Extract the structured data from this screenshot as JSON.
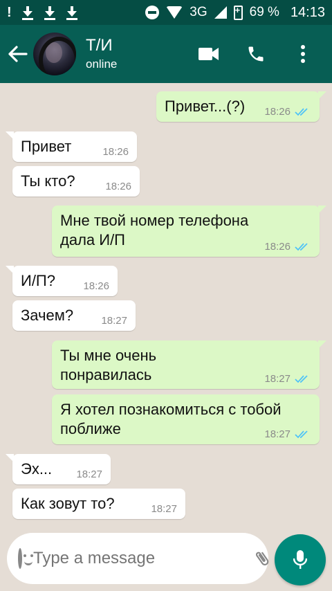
{
  "status_bar": {
    "network": "3G",
    "battery": "69 %",
    "time": "14:13"
  },
  "header": {
    "contact_name": "Т/И",
    "contact_status": "online"
  },
  "messages": [
    {
      "direction": "out",
      "text": "Привет...(?)",
      "time": "18:26",
      "read": true
    },
    {
      "direction": "in",
      "text": "Привет",
      "time": "18:26"
    },
    {
      "direction": "in",
      "text": "Ты кто?",
      "time": "18:26"
    },
    {
      "direction": "out",
      "text": "Мне твой номер телефона\nдала И/П",
      "time": "18:26",
      "read": true
    },
    {
      "direction": "in",
      "text": "И/П?",
      "time": "18:26"
    },
    {
      "direction": "in",
      "text": "Зачем?",
      "time": "18:27"
    },
    {
      "direction": "out",
      "text": "Ты мне очень\nпонравилась",
      "time": "18:27",
      "read": true
    },
    {
      "direction": "out",
      "text": "Я хотел познакомиться с тобой\nпоближе",
      "time": "18:27",
      "read": true
    },
    {
      "direction": "in",
      "text": "Эх...",
      "time": "18:27"
    },
    {
      "direction": "in",
      "text": "Как зовут то?",
      "time": "18:27"
    }
  ],
  "composer": {
    "placeholder": "Type a message"
  },
  "colors": {
    "header": "#075e54",
    "status_bar": "#054d44",
    "outgoing_bubble": "#dcf8c6",
    "incoming_bubble": "#ffffff",
    "chat_background": "#e5ddd5",
    "mic_button": "#00897b",
    "read_ticks": "#4fc3f7"
  }
}
